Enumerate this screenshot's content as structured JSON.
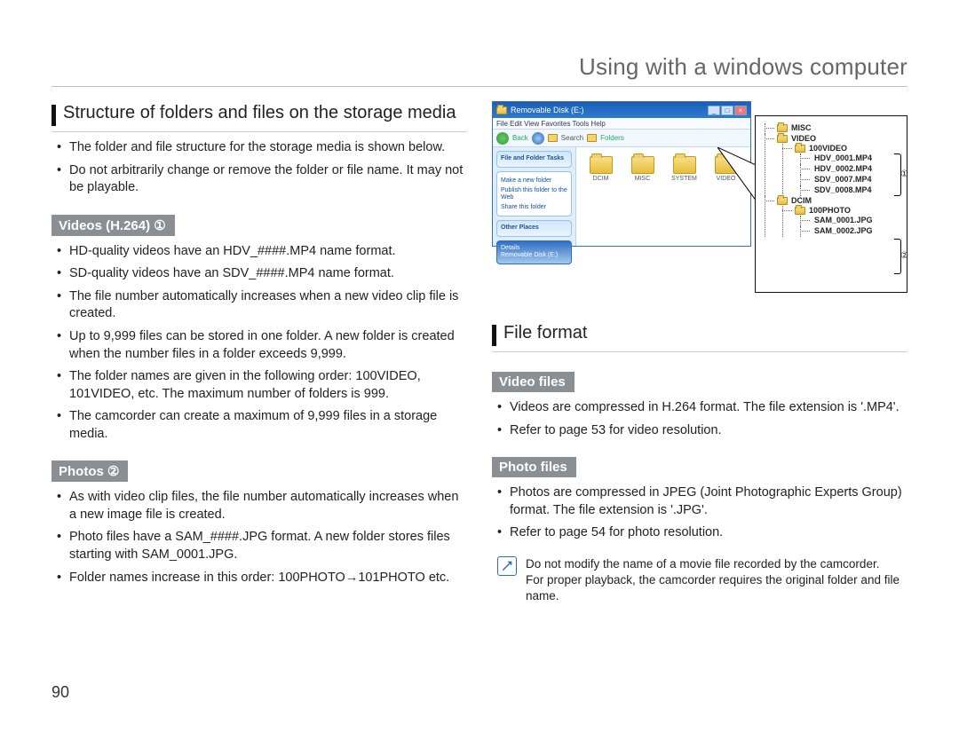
{
  "chapter_title": "Using with a windows computer",
  "page_number": "90",
  "left": {
    "section1_title": "Structure of folders and files on the storage media",
    "s1_b1": "The folder and file structure for the storage media is shown below.",
    "s1_b2": "Do not arbitrarily change or remove the folder or file name. It may not be playable.",
    "sub_videos": "Videos (H.264) ①",
    "v_b1": "HD-quality videos have an HDV_####.MP4 name format.",
    "v_b2": "SD-quality videos have an SDV_####.MP4 name format.",
    "v_b3": "The file number automatically increases when a new video clip file is created.",
    "v_b4": "Up to 9,999 files can be stored in one folder. A new folder is created when the number files in a folder exceeds 9,999.",
    "v_b5": "The folder names are given in the following order: 100VIDEO, 101VIDEO, etc. The maximum number of folders is 999.",
    "v_b6": "The camcorder can create a maximum of 9,999 files in a storage media.",
    "sub_photos": "Photos ②",
    "p_b1": "As with video clip files, the file number automatically increases when a new image file is created.",
    "p_b2": "Photo files have a SAM_####.JPG format. A new folder stores files starting with SAM_0001.JPG.",
    "p_b3": "Folder names increase in this order: 100PHOTO→101PHOTO etc."
  },
  "right": {
    "explorer": {
      "title": "Removable Disk (E:)",
      "menu": "File   Edit   View   Favorites   Tools   Help",
      "tool_back": "Back",
      "tool_search": "Search",
      "tool_folders": "Folders",
      "side_hdr": "File and Folder Tasks",
      "side_l1": "Make a new folder",
      "side_l2": "Publish this folder to the Web",
      "side_l3": "Share this folder",
      "side_other": "Other Places",
      "side_details_h": "Details",
      "side_details": "Removable Disk (E:)",
      "f1": "DCIM",
      "f2": "MISC",
      "f3": "SYSTEM",
      "f4": "VIDEO"
    },
    "tree": {
      "misc": "MISC",
      "video": "VIDEO",
      "video_sub": "100VIDEO",
      "vfile1": "HDV_0001.MP4",
      "vfile2": "HDV_0002.MP4",
      "vfile3": "SDV_0007.MP4",
      "vfile4": "SDV_0008.MP4",
      "dcim": "DCIM",
      "dcim_sub": "100PHOTO",
      "pfile1": "SAM_0001.JPG",
      "pfile2": "SAM_0002.JPG",
      "ann1": "①",
      "ann2": "②"
    },
    "section2_title": "File format",
    "sub_video_files": "Video files",
    "vf_b1": "Videos are compressed in H.264 format. The file extension is '.MP4'.",
    "vf_b2": "Refer to page 53 for video resolution.",
    "sub_photo_files": "Photo files",
    "pf_b1": "Photos are compressed in JPEG (Joint Photographic Experts Group) format. The file extension is '.JPG'.",
    "pf_b2": "Refer to page 54 for photo resolution.",
    "note_l1": "Do not modify the name of a movie file recorded by the camcorder.",
    "note_l2": "For proper playback, the camcorder requires the original folder and file name."
  }
}
